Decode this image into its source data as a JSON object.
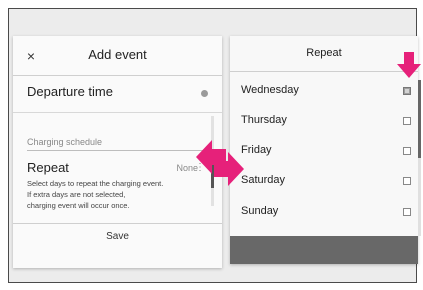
{
  "add_event": {
    "close_label": "×",
    "title": "Add event",
    "departure_time_label": "Departure time",
    "charging_schedule_label": "Charging schedule",
    "repeat_label": "Repeat",
    "repeat_value": "None",
    "repeat_more": "⋮",
    "repeat_description_line1": "Select days to repeat the charging event.",
    "repeat_description_line2": "If extra days are not selected,",
    "repeat_description_line3": "charging event will occur once.",
    "save_label": "Save"
  },
  "repeat_panel": {
    "title": "Repeat",
    "days": [
      {
        "label": "Wednesday",
        "checked": true
      },
      {
        "label": "Thursday",
        "checked": false
      },
      {
        "label": "Friday",
        "checked": false
      },
      {
        "label": "Saturday",
        "checked": false
      },
      {
        "label": "Sunday",
        "checked": false
      }
    ]
  },
  "colors": {
    "arrow": "#e6217a",
    "bottom_bar": "#686868"
  }
}
